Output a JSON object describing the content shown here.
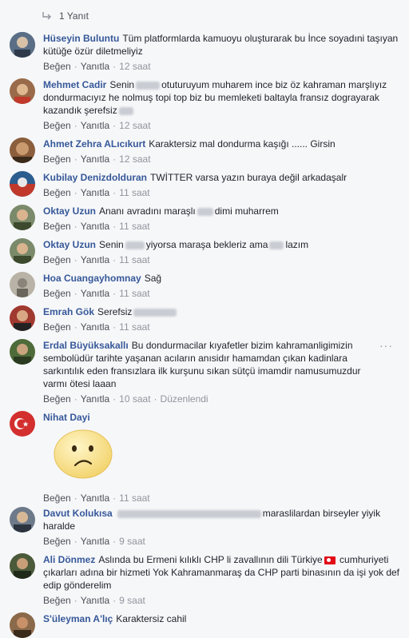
{
  "reply_count": "1 Yanıt",
  "actions": {
    "like": "Beğen",
    "reply": "Yanıtla",
    "sep": "·",
    "edited": "Düzenlendi"
  },
  "comments": [
    {
      "author": "Hüseyin Buluntu",
      "text": "Tüm platformlarda kamuoyu oluşturarak bu İnce soyadıni taşıyan kütüğe özür diletmeliyiz",
      "time": "12 saat",
      "avatar_color": "#5a6f86"
    },
    {
      "author": "Mehmet Cadir",
      "text_a": "Senin",
      "text_b": "otuturuyum muharem ince biz öz kahraman marşlıyız dondurmacıyız he nolmuş topi top biz bu memleketi baltayla fransız dograyarak kazandık şerefsiz",
      "time": "12 saat",
      "avatar_color": "#9a6b4a"
    },
    {
      "author": "Ahmet Zehra ALıcıkurt",
      "text": "Karaktersiz mal dondurma kaşığı ...... Girsin",
      "time": "12 saat",
      "avatar_color": "#8b5e3c"
    },
    {
      "author": "Kubilay Denizdolduran",
      "text": "TWİTTER varsa yazın buraya değil arkadaşalr",
      "time": "11 saat",
      "avatar_color": "#c0392b"
    },
    {
      "author": "Oktay Uzun",
      "text_a": "Ananı avradını maraşlı",
      "text_b": "dimi muharrem",
      "time": "11 saat",
      "avatar_color": "#7a8a6a"
    },
    {
      "author": "Oktay Uzun",
      "text_a": "Senin",
      "text_b": "yiyorsa maraşa bekleriz ama",
      "text_c": "lazım",
      "time": "11 saat",
      "avatar_color": "#7a8a6a"
    },
    {
      "author": "Hoa Cuangayhomnay",
      "text": "Sağ",
      "time": "11 saat",
      "avatar_color": "#b8b3a6"
    },
    {
      "author": "Emrah Gök",
      "text": "Serefsiz",
      "time": "11 saat",
      "avatar_color": "#a0392f"
    },
    {
      "author": "Erdal Büyüksakallı",
      "text": "Bu dondurmacilar kıyafetler bizim kahramanligimizin sembolüdür tarihte yaşanan acıların anısidır hamamdan çıkan kadinlara sarkıntılık eden fransızlara ilk kurşunu sıkan sütçü imamdir namusumuzdur varmı ötesi laaan",
      "time": "10 saat",
      "avatar_color": "#4e6b3a",
      "edited": true
    },
    {
      "author": "Nihat Dayi",
      "text": "",
      "time": "11 saat",
      "avatar_color": "#d32f2f",
      "has_sticker": true
    },
    {
      "author": "Davut Kolukısa",
      "text": "maraslilardan birseyler yiyik haralde",
      "time": "9 saat",
      "avatar_color": "#6d7a8a"
    },
    {
      "author": "Ali Dönmez",
      "text_a": "Aslında bu Ermeni kılıklı CHP li zavallının dili Türkiye",
      "text_b": "cumhuriyeti çıkarları adına bir hizmeti Yok Kahramanmaraş da CHP parti binasının da işi yok def edip gönderelim",
      "time": "9 saat",
      "avatar_color": "#4a5a3a"
    },
    {
      "author": "S'üleyman A'lıç",
      "text": "Karaktersiz cahil",
      "time": "",
      "avatar_color": "#8a6a4a"
    }
  ]
}
